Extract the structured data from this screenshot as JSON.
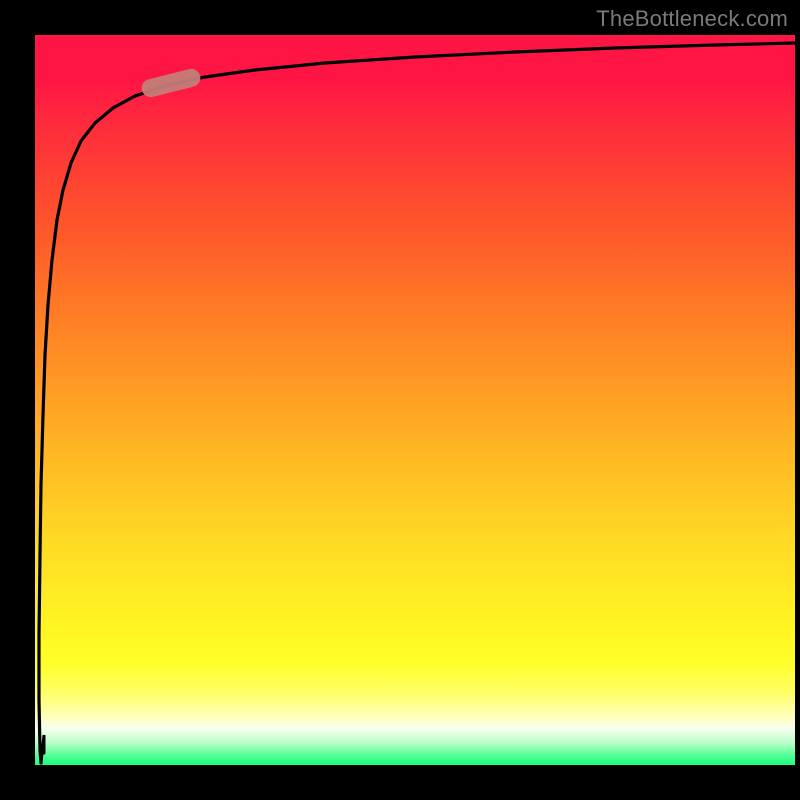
{
  "watermark": "TheBottleneck.com",
  "colors": {
    "background": "#000000",
    "curve": "#000000",
    "marker": "#c47c77",
    "gradient_top": "#ff1544",
    "gradient_mid": "#ffea24",
    "gradient_bottom": "#17ff80"
  },
  "chart_data": {
    "type": "line",
    "title": "",
    "xlabel": "",
    "ylabel": "",
    "xlim": [
      0,
      100
    ],
    "ylim": [
      0,
      100
    ],
    "grid": false,
    "legend": false,
    "series": [
      {
        "name": "curve",
        "x": [
          0.5,
          0.6,
          0.8,
          1,
          1.5,
          2,
          3,
          4,
          6,
          8,
          12,
          16,
          24,
          32,
          48,
          64,
          80,
          96,
          100
        ],
        "y": [
          2,
          10,
          30,
          45,
          62,
          72,
          80,
          84,
          88,
          90,
          92,
          93,
          94.5,
          95.5,
          96.5,
          97.2,
          97.7,
          98.1,
          98.2
        ]
      }
    ],
    "annotations": [
      {
        "name": "highlight-segment",
        "x_range": [
          14,
          22
        ],
        "y_range": [
          92.5,
          94
        ],
        "note": "pink pill marker on curve near upper-left bend"
      }
    ]
  }
}
